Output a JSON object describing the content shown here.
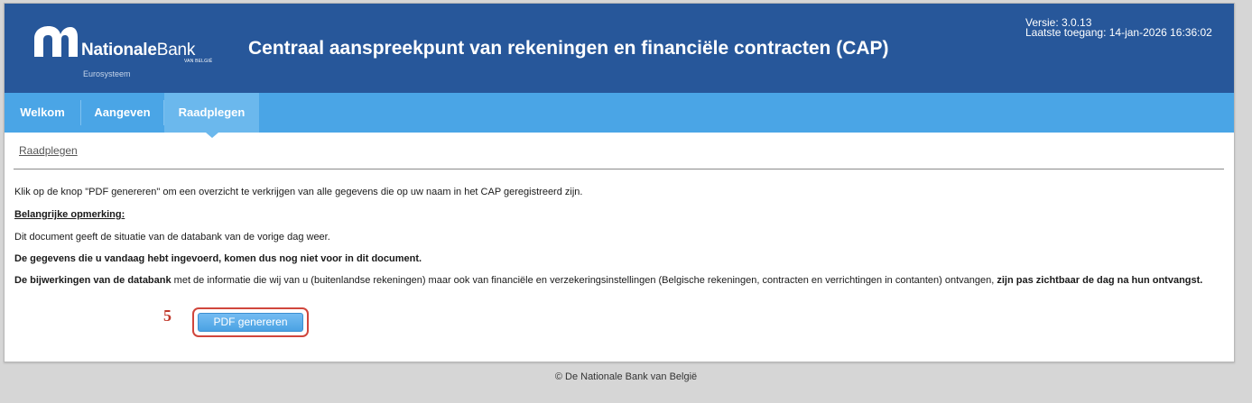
{
  "header": {
    "logo_name_bold": "Nationale",
    "logo_name_light": "Bank",
    "logo_subtitle": "VAN BELGIË",
    "logo_tagline": "Eurosysteem",
    "title": "Centraal aanspreekpunt van rekeningen en financiële contracten (CAP)",
    "version": "Versie: 3.0.13",
    "last_access": "Laatste toegang: 14-jan-2026 16:36:02",
    "logo_icon": "nbb-logo-icon"
  },
  "nav": {
    "tabs": [
      {
        "label": "Welkom",
        "active": false
      },
      {
        "label": "Aangeven",
        "active": false
      },
      {
        "label": "Raadplegen",
        "active": true
      }
    ]
  },
  "breadcrumb": "Raadplegen",
  "content": {
    "intro": "Klik op de knop \"PDF genereren\" om een overzicht te verkrijgen van alle gegevens die op uw naam in het CAP geregistreerd zijn.",
    "note_heading": "Belangrijke opmerking:",
    "note_1": "Dit document geeft de situatie van de databank van de vorige dag weer.",
    "note_2": "De gegevens die u vandaag hebt ingevoerd, komen dus nog niet voor in dit document.",
    "note_3_bold_start": "De bijwerkingen van de databank",
    "note_3_middle": " met de informatie die wij van u (buitenlandse rekeningen) maar ook van financiële en verzekeringsinstellingen (Belgische rekeningen, contracten en verrichtingen in contanten) ontvangen, ",
    "note_3_bold_end": "zijn pas zichtbaar de dag na hun ontvangst."
  },
  "annotation": {
    "step_number": "5"
  },
  "button": {
    "label": "PDF genereren"
  },
  "footer": "© De Nationale Bank van België",
  "colors": {
    "header_bg": "#27579a",
    "nav_bg": "#4aa5e6",
    "active_tab_bg": "#6bb8ed",
    "highlight": "#d0463c"
  }
}
